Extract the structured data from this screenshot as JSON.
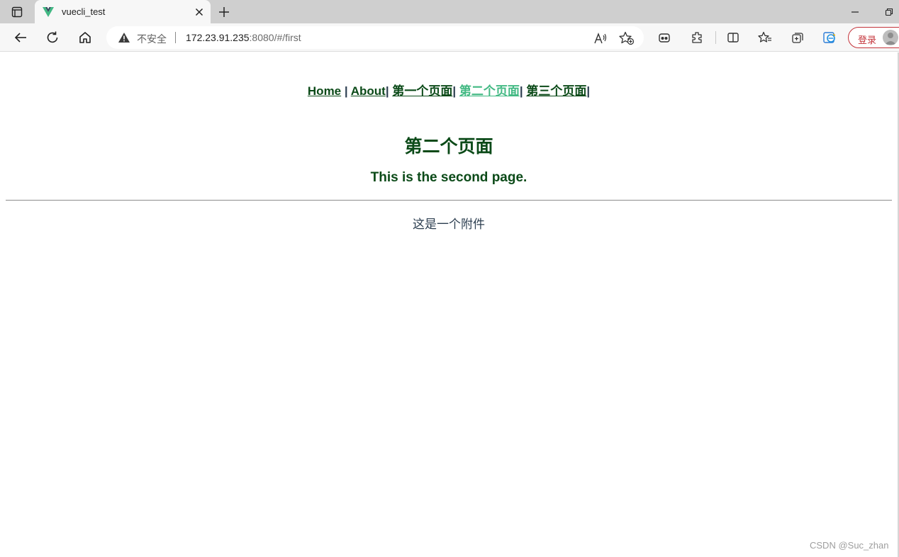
{
  "tab": {
    "title": "vuecli_test"
  },
  "addressbar": {
    "security_label": "不安全",
    "url_host": "172.23.91.235",
    "url_rest": ":8080/#/first"
  },
  "toolbar": {
    "signin_label": "登录"
  },
  "nav": {
    "links": [
      {
        "label": "Home",
        "active": false
      },
      {
        "label": "About",
        "active": false
      },
      {
        "label": "第一个页面",
        "active": false
      },
      {
        "label": "第二个页面",
        "active": true
      },
      {
        "label": "第三个页面",
        "active": false
      }
    ],
    "separator": "|"
  },
  "content": {
    "heading": "第二个页面",
    "subheading": "This is the second page.",
    "attachment": "这是一个附件"
  },
  "watermark": "CSDN @Suc_zhan",
  "colors": {
    "link": "#0b4a18",
    "active_link": "#42b983",
    "heading": "#0b4a18",
    "body_text": "#2c3e50",
    "signin_accent": "#c4343b"
  },
  "icons": {
    "tab_actions": "tab-actions-icon",
    "favicon": "vue-logo-icon",
    "close": "close-icon",
    "new_tab": "plus-icon",
    "back": "back-arrow-icon",
    "refresh": "refresh-icon",
    "home": "home-icon",
    "warning": "warning-triangle-icon",
    "read_aloud": "read-aloud-icon",
    "favorite_add": "star-plus-icon"
  }
}
